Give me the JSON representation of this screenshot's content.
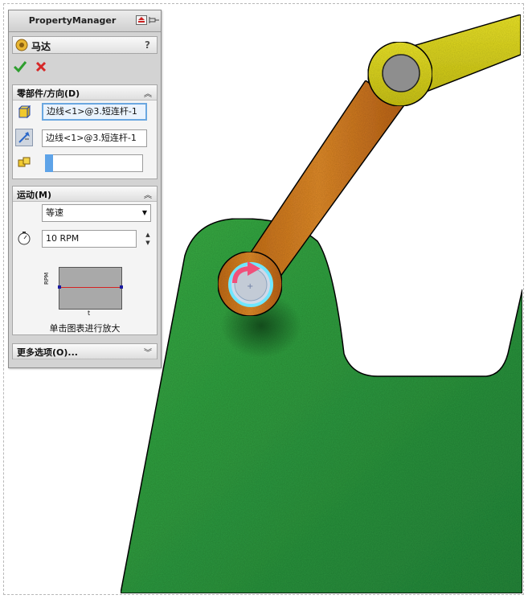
{
  "property_manager": {
    "title": "PropertyManager",
    "feature_name": "马达",
    "help_label": "?"
  },
  "components_section": {
    "title": "零部件/方向(D)",
    "component_field_value": "边线<1>@3.短连杆-1",
    "direction_field_value": "边线<1>@3.短连杆-1",
    "load_field_value": ""
  },
  "motion_section": {
    "title": "运动(M)",
    "motion_type_selected": "等速",
    "speed_value": "10 RPM",
    "graph_y_label": "RPM",
    "graph_x_label": "t",
    "graph_caption": "单击图表进行放大"
  },
  "more_options_section": {
    "title": "更多选项(O)..."
  },
  "colors": {
    "pm_background": "#d3d3d3",
    "accept_green": "#2e9e2e",
    "cancel_red": "#d62828",
    "frame_green": "#2f9a3a",
    "crank_orange": "#d0751f",
    "link_yellow": "#e6e01e",
    "motor_arrow_pink": "#f0507a",
    "highlight_cyan": "#6fe6ff"
  },
  "icons": {
    "feature_icon": "motor-icon",
    "accept_icon": "checkmark-icon",
    "cancel_icon": "x-icon",
    "component_icon": "component-cube-icon",
    "direction_icon": "reverse-direction-icon",
    "load_icon": "load-bearing-faces-icon",
    "speed_icon": "stopwatch-icon",
    "expand_icon": "chevron-double-up-icon",
    "collapse_icon": "chevron-double-down-icon"
  }
}
